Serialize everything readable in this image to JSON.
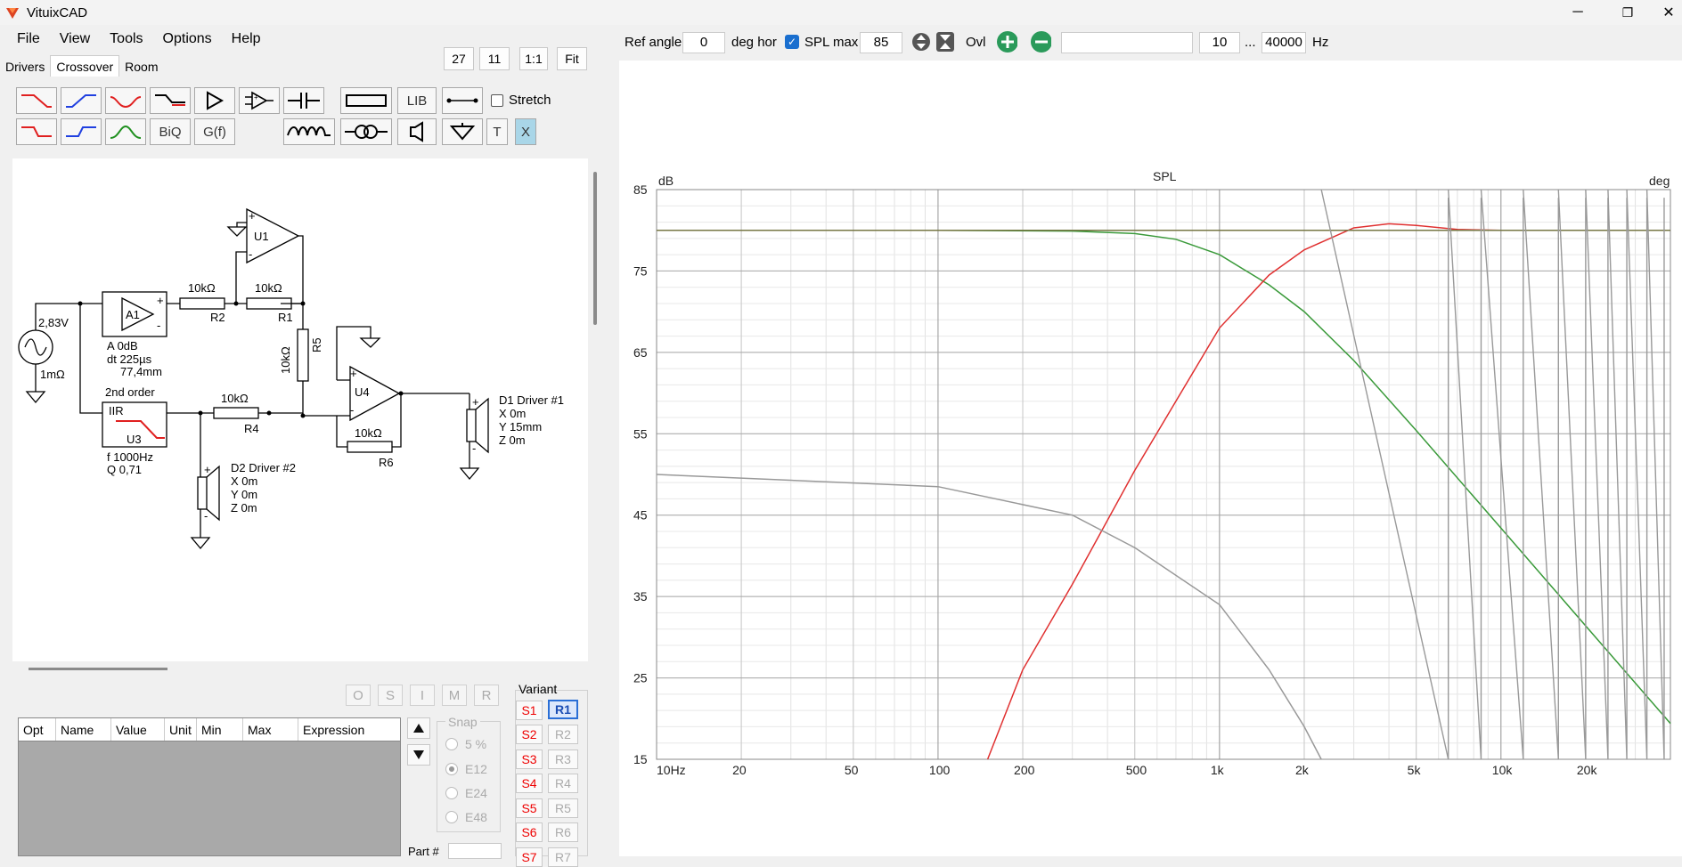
{
  "app": {
    "title": "VituixCAD",
    "minimize": "─",
    "restore": "❐",
    "close": "✕"
  },
  "menu": [
    "File",
    "View",
    "Tools",
    "Options",
    "Help"
  ],
  "tabs": [
    "Drivers",
    "Crossover",
    "Room"
  ],
  "zoom": {
    "a": "27",
    "b": "11",
    "c": "1:1",
    "d": "Fit"
  },
  "toolbar": {
    "lib": "LIB",
    "biq": "BiQ",
    "gf": "G(f)",
    "t": "T",
    "x": "X",
    "stretch": "Stretch"
  },
  "schematic": {
    "source_voltage": "2,83V",
    "source_res": "1mΩ",
    "a1": {
      "name": "A1",
      "gain": "A 0dB",
      "delay": "dt 225µs",
      "dist": "77,4mm"
    },
    "u1": "U1",
    "u3": {
      "name": "U3",
      "order": "2nd order",
      "type": "IIR",
      "f": "f 1000Hz",
      "q": "Q 0,71"
    },
    "u4": "U4",
    "r2": {
      "name": "R2",
      "value": "10kΩ"
    },
    "r1": {
      "name": "R1",
      "value": "10kΩ"
    },
    "r5": {
      "name": "R5",
      "value": "10kΩ"
    },
    "r4": {
      "name": "R4",
      "value": "10kΩ"
    },
    "r6": {
      "name": "R6",
      "value": "10kΩ"
    },
    "d1": {
      "name": "D1 Driver #1",
      "x": "X 0m",
      "y": "Y 15mm",
      "z": "Z 0m"
    },
    "d2": {
      "name": "D2 Driver #2",
      "x": "X 0m",
      "y": "Y 0m",
      "z": "Z 0m"
    }
  },
  "opt_buttons": [
    "O",
    "S",
    "I",
    "M",
    "R"
  ],
  "opt_table": {
    "columns": [
      "Opt",
      "Name",
      "Value",
      "Unit",
      "Min",
      "Max",
      "Expression"
    ]
  },
  "snap": {
    "label": "Snap",
    "options": [
      "5 %",
      "E12",
      "E24",
      "E48"
    ],
    "selected": "E12"
  },
  "variant": {
    "label": "Variant",
    "s": [
      "S1",
      "S2",
      "S3",
      "S4",
      "S5",
      "S6",
      "S7"
    ],
    "r": [
      "R1",
      "R2",
      "R3",
      "R4",
      "R5",
      "R6",
      "R7"
    ],
    "active": "R1"
  },
  "part_label": "Part #",
  "controls": {
    "ref_angle_label": "Ref angle",
    "ref_angle": "0",
    "deg_hor": "deg hor",
    "spl_max_label": "SPL max",
    "spl_max_checked": true,
    "spl_max": "85",
    "ovl": "Ovl",
    "search": "",
    "fmin": "10",
    "ellipsis": "...",
    "fmax": "40000",
    "hz": "Hz"
  },
  "chart_data": {
    "type": "line",
    "title": "SPL",
    "ylabel": "dB",
    "y2label": "deg",
    "xscale": "log",
    "xlim": [
      10,
      40000
    ],
    "ylim": [
      15,
      85
    ],
    "xticks": [
      "10Hz",
      "20",
      "50",
      "100",
      "200",
      "500",
      "1k",
      "2k",
      "5k",
      "10k",
      "20k"
    ],
    "xtick_values": [
      10,
      20,
      50,
      100,
      200,
      500,
      1000,
      2000,
      5000,
      10000,
      20000
    ],
    "yticks": [
      85,
      75,
      65,
      55,
      45,
      35,
      25,
      15
    ],
    "grid": true,
    "colors": {
      "lowpass": "#3a9a3a",
      "highpass": "#e03030",
      "sum": "#d02020",
      "phase": "#999999",
      "flat": "#777744"
    },
    "series": [
      {
        "role": "lowpass",
        "color": "#3a9a3a",
        "x": [
          10,
          100,
          300,
          500,
          700,
          1000,
          1500,
          2000,
          3000,
          5000,
          10000,
          20000,
          40000
        ],
        "y": [
          80,
          80,
          79.9,
          79.6,
          78.9,
          77,
          73.3,
          70,
          64,
          55.4,
          43.4,
          31.4,
          19.4
        ]
      },
      {
        "role": "highpass",
        "color": "#e03030",
        "x": [
          150,
          200,
          300,
          500,
          700,
          1000,
          1500,
          2000,
          3000,
          4000,
          5000,
          7000,
          10000,
          20000,
          40000
        ],
        "y": [
          15,
          26,
          36.5,
          50.5,
          59,
          68,
          74.5,
          77.6,
          80.3,
          80.8,
          80.6,
          80.1,
          80,
          80,
          80
        ]
      },
      {
        "role": "offaxis",
        "color": "#999999",
        "x": [
          10,
          100,
          300,
          500,
          1000,
          1500,
          2000,
          2300
        ],
        "y": [
          50,
          48.5,
          45,
          41,
          34,
          26,
          19,
          15
        ]
      },
      {
        "role": "flat",
        "color": "#777744",
        "x": [
          10,
          40000
        ],
        "y": [
          80,
          80
        ]
      }
    ],
    "phase_wraps": [
      2300,
      6500,
      8500,
      12000,
      16000,
      20000,
      24000,
      28000,
      33000,
      38000
    ]
  }
}
